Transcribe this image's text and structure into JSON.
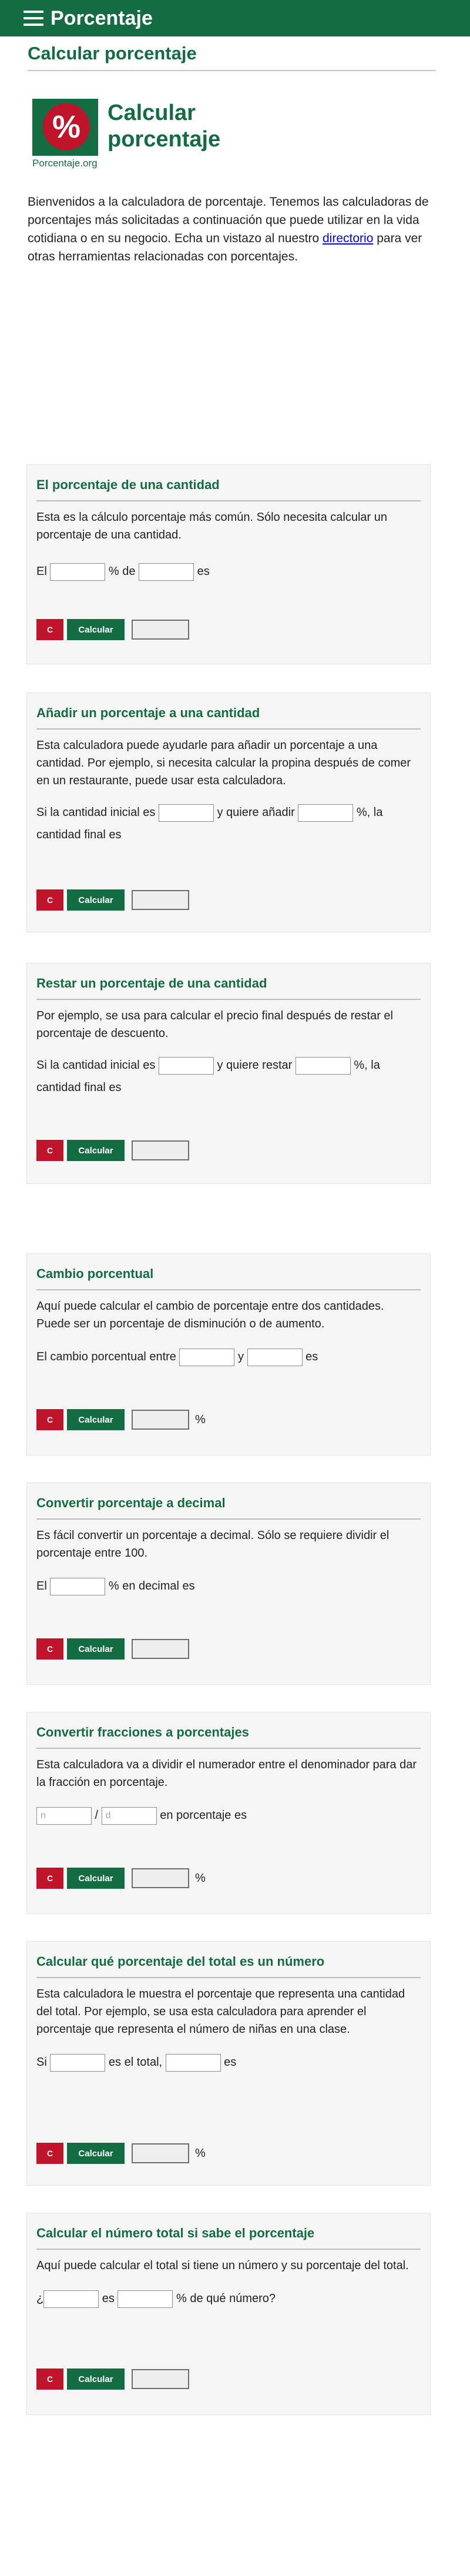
{
  "header": {
    "brand": "Porcentaje"
  },
  "page": {
    "title": "Calcular porcentaje"
  },
  "logo": {
    "symbol": "%",
    "caption": "Porcentaje.org"
  },
  "hero": {
    "title_line1": "Calcular",
    "title_line2": "porcentaje"
  },
  "intro": {
    "text_before": "Bienvenidos a la calculadora de porcentaje. Tenemos las calculadoras de porcentajes más solicitadas a continuación que puede utilizar en la vida cotidiana o en su negocio. Echa un vistazo al nuestro ",
    "link": "directorio",
    "text_after": " para ver otras herramientas relacionadas con porcentajes."
  },
  "buttons": {
    "clear": "C",
    "calculate": "Calcular"
  },
  "colors": {
    "brand_green": "#146c43",
    "accent_red": "#c0142b",
    "card_bg": "#f5f5f5"
  },
  "calculators": {
    "c1": {
      "title": "El porcentaje de una cantidad",
      "desc": "Esta es la cálculo porcentaje más común. Sólo necesita calcular un porcentaje de una cantidad.",
      "t1": "El ",
      "t2": " % de ",
      "t3": " es"
    },
    "c2": {
      "title": "Añadir un porcentaje a una cantidad",
      "desc": "Esta calculadora puede ayudarle para añadir un porcentaje a una cantidad. Por ejemplo, si necesita calcular la propina después de comer en un restaurante, puede usar esta calculadora.",
      "t1": "Si la cantidad inicial es ",
      "t2": " y quiere añadir ",
      "t3": " %, la cantidad final es"
    },
    "c3": {
      "title": "Restar un porcentaje de una cantidad",
      "desc": "Por ejemplo, se usa para calcular el precio final después de restar el porcentaje de descuento.",
      "t1": "Si la cantidad inicial es ",
      "t2": " y quiere restar ",
      "t3": " %, la cantidad final es"
    },
    "c4": {
      "title": "Cambio porcentual",
      "desc": "Aquí puede calcular el cambio de porcentaje entre dos cantidades. Puede ser un porcentaje de disminución o de aumento.",
      "t1": "El cambio porcentual entre ",
      "t2": " y ",
      "t3": " es",
      "suffix": "%"
    },
    "c5": {
      "title": "Convertir porcentaje a decimal",
      "desc": "Es fácil convertir un porcentaje a decimal. Sólo se requiere dividir el porcentaje entre 100.",
      "t1": "El ",
      "t2": " % en decimal es"
    },
    "c6": {
      "title": "Convertir fracciones a porcentajes",
      "desc": "Esta calculadora va a dividir el numerador entre el denominador para dar la fracción en porcentaje.",
      "ph_n": "n",
      "t_slash": " / ",
      "ph_d": "d",
      "t2": " en porcentaje es",
      "suffix": "%"
    },
    "c7": {
      "title": "Calcular qué porcentaje del total es un número",
      "desc": "Esta calculadora le muestra el porcentaje que representa una cantidad del total. Por ejemplo, se usa esta calculadora para aprender el porcentaje que representa el número de niñas en una clase.",
      "t1": "Si ",
      "t2": " es el total, ",
      "t3": " es",
      "suffix": "%"
    },
    "c8": {
      "title": "Calcular el número total si sabe el porcentaje",
      "desc": "Aquí puede calcular el total si tiene un número y su porcentaje del total.",
      "t1": "¿",
      "t2": " es ",
      "t3": " % de qué número?"
    }
  }
}
